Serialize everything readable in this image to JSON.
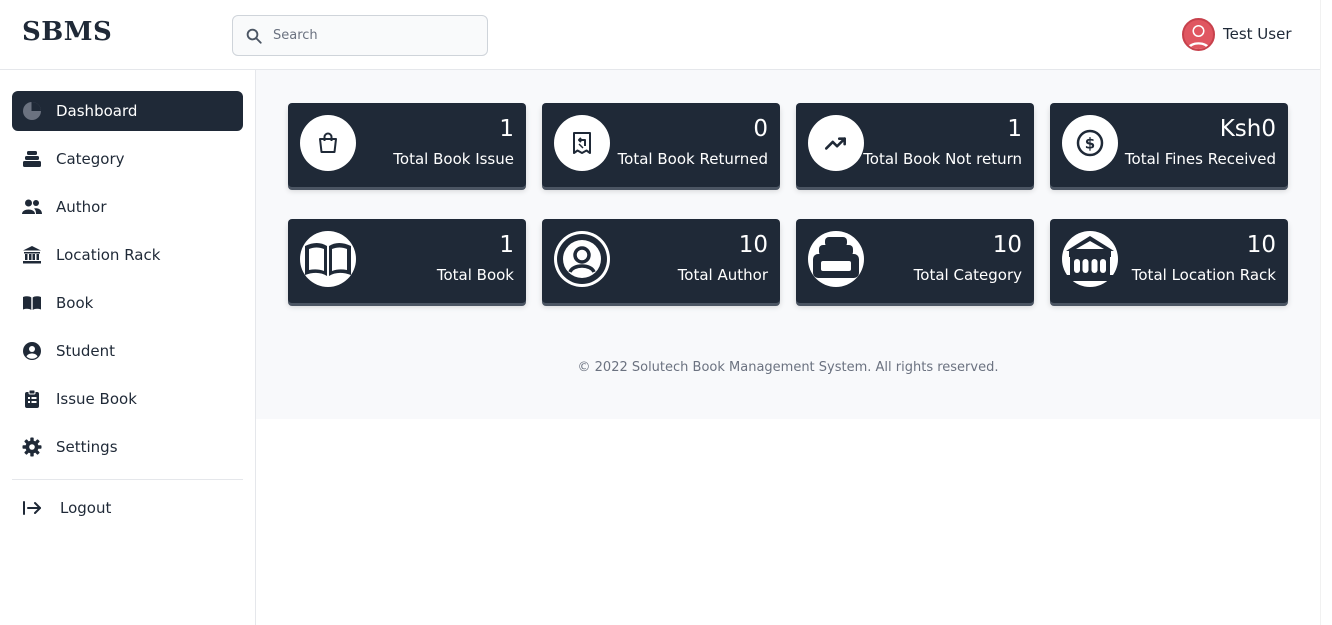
{
  "header": {
    "brand": "SBMS",
    "search": {
      "placeholder": "Search",
      "value": ""
    },
    "user": {
      "name": "Test User",
      "avatar_color": "#e05661"
    }
  },
  "sidebar": {
    "items": [
      {
        "label": "Dashboard",
        "icon": "pie-chart-icon",
        "active": true
      },
      {
        "label": "Category",
        "icon": "stack-icon",
        "active": false
      },
      {
        "label": "Author",
        "icon": "users-icon",
        "active": false
      },
      {
        "label": "Location Rack",
        "icon": "bank-icon",
        "active": false
      },
      {
        "label": "Book",
        "icon": "book-open-icon",
        "active": false
      },
      {
        "label": "Student",
        "icon": "user-circle-icon",
        "active": false
      },
      {
        "label": "Issue Book",
        "icon": "clipboard-list-icon",
        "active": false
      },
      {
        "label": "Settings",
        "icon": "gear-icon",
        "active": false
      }
    ],
    "logout": {
      "label": "Logout",
      "icon": "logout-icon"
    }
  },
  "stats": {
    "row1": [
      {
        "value": "1",
        "label": "Total Book Issue",
        "icon": "shopping-bag-icon"
      },
      {
        "value": "0",
        "label": "Total Book Returned",
        "icon": "receipt-refund-icon"
      },
      {
        "value": "1",
        "label": "Total Book Not return",
        "icon": "trending-up-icon"
      },
      {
        "value": "Ksh0",
        "label": "Total Fines Received",
        "icon": "dollar-circle-icon"
      }
    ],
    "row2": [
      {
        "value": "1",
        "label": "Total Book",
        "icon": "book-open-icon"
      },
      {
        "value": "10",
        "label": "Total Author",
        "icon": "user-circle-icon"
      },
      {
        "value": "10",
        "label": "Total Category",
        "icon": "stack-icon"
      },
      {
        "value": "10",
        "label": "Total Location Rack",
        "icon": "bank-icon"
      }
    ]
  },
  "footer": {
    "text": "© 2022 Solutech Book Management System. All rights reserved."
  },
  "colors": {
    "card_bg": "#1f2937",
    "active_nav_bg": "#1f2937",
    "main_bg": "#f8f9fb"
  }
}
